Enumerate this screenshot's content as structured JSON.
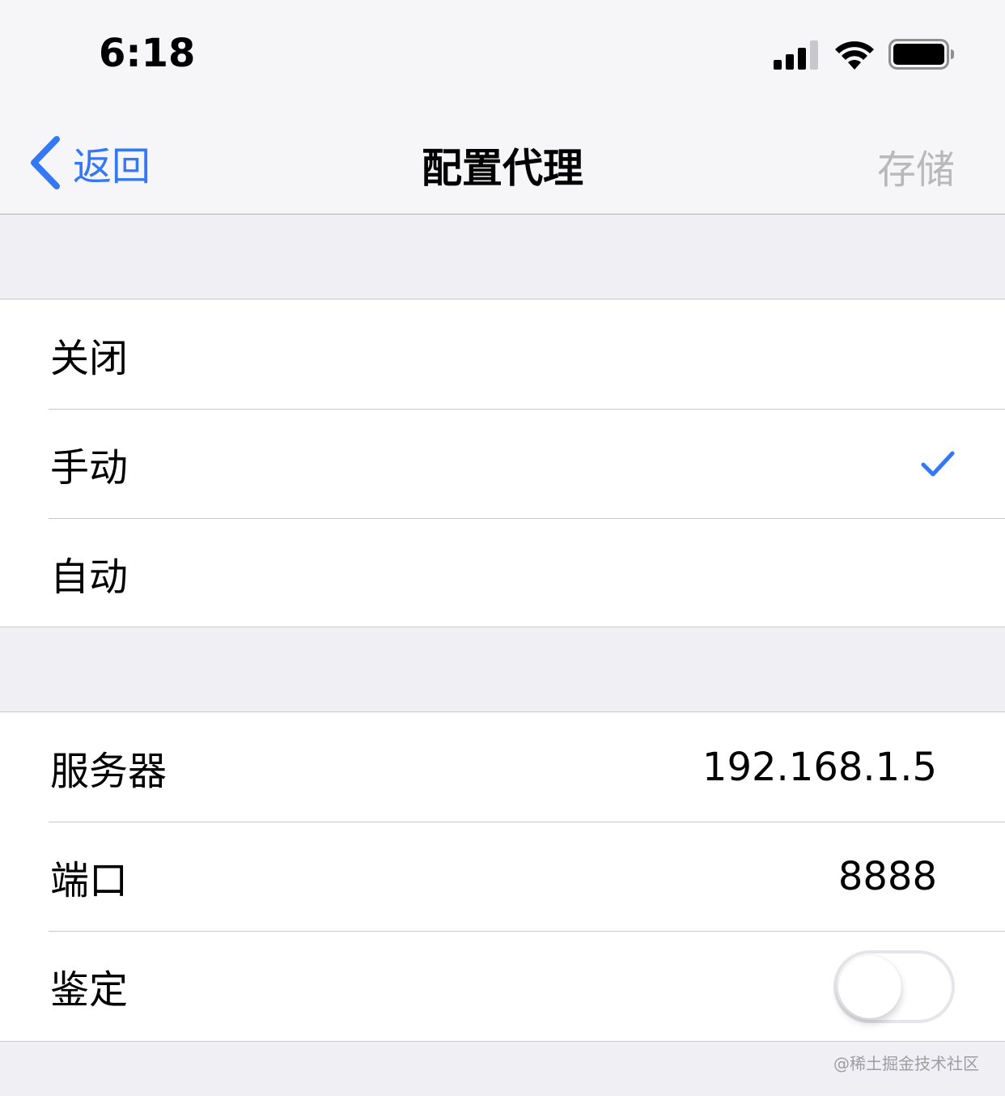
{
  "status_bar": {
    "time": "6:18",
    "signal_icon": "cellular-signal-icon",
    "wifi_icon": "wifi-icon",
    "battery_icon": "battery-icon"
  },
  "nav": {
    "back_label": "返回",
    "title": "配置代理",
    "save_label": "存储",
    "accent_color": "#3478f6",
    "disabled_color": "#b8b8bd"
  },
  "proxy_mode": {
    "options": [
      {
        "label": "关闭",
        "selected": false
      },
      {
        "label": "手动",
        "selected": true
      },
      {
        "label": "自动",
        "selected": false
      }
    ]
  },
  "settings": {
    "server_label": "服务器",
    "server_value": "192.168.1.5",
    "port_label": "端口",
    "port_value": "8888",
    "auth_label": "鉴定",
    "auth_enabled": false
  },
  "watermark": "@稀土掘金技术社区"
}
